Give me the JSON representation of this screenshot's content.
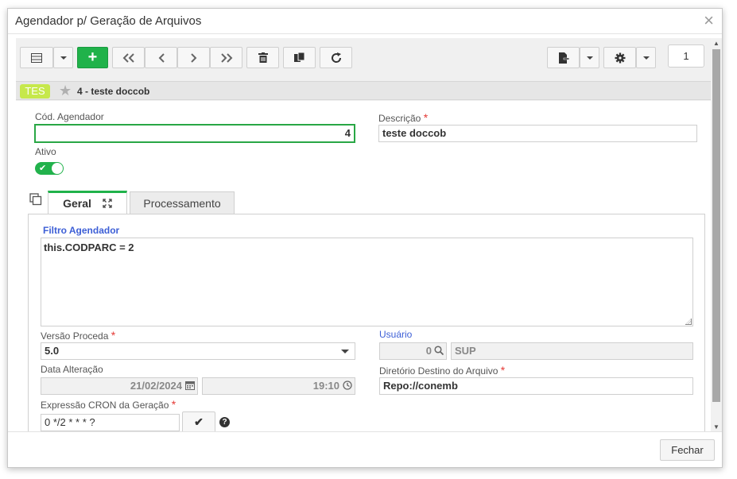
{
  "window": {
    "title": "Agendador p/ Geração de Arquivos",
    "close_glyph": "×"
  },
  "toolbar": {
    "add_glyph": "+",
    "page_number": "1"
  },
  "record": {
    "badge": "TES",
    "title": "4 - teste doccob"
  },
  "form": {
    "cod_label": "Cód. Agendador",
    "cod_value": "4",
    "descricao_label": "Descrição",
    "descricao_value": "teste doccob",
    "ativo_label": "Ativo",
    "ativo_on": true,
    "required_mark": "*"
  },
  "tabs": [
    {
      "label": "Geral",
      "active": true
    },
    {
      "label": "Processamento",
      "active": false
    }
  ],
  "geral": {
    "filtro_label": "Filtro Agendador",
    "filtro_value": "this.CODPARC = 2",
    "versao_label": "Versão Proceda",
    "versao_value": "5.0",
    "usuario_label": "Usuário",
    "usuario_code": "0",
    "usuario_name": "SUP",
    "data_label": "Data Alteração",
    "data_value": "21/02/2024",
    "hora_value": "19:10",
    "diretorio_label": "Diretório Destino do Arquivo",
    "diretorio_value": "Repo://conemb",
    "cron_label": "Expressão CRON da Geração",
    "cron_value": "0 */2 * * * ?",
    "help_glyph": "?"
  },
  "footer": {
    "close_label": "Fechar"
  },
  "colors": {
    "accent_green": "#20b24a",
    "badge_lime": "#c6e84b",
    "link_blue": "#3d5fd6",
    "required_red": "#e53935"
  },
  "icons": [
    "grid-view-icon",
    "chevron-down-icon",
    "add-icon",
    "first-icon",
    "previous-icon",
    "next-icon",
    "last-icon",
    "trash-icon",
    "duplicate-icon",
    "refresh-icon",
    "export-icon",
    "gear-icon",
    "star-icon",
    "copy-icon",
    "expand-icon",
    "calendar-icon",
    "clock-icon",
    "search-icon",
    "check-icon",
    "help-icon",
    "close-icon"
  ]
}
